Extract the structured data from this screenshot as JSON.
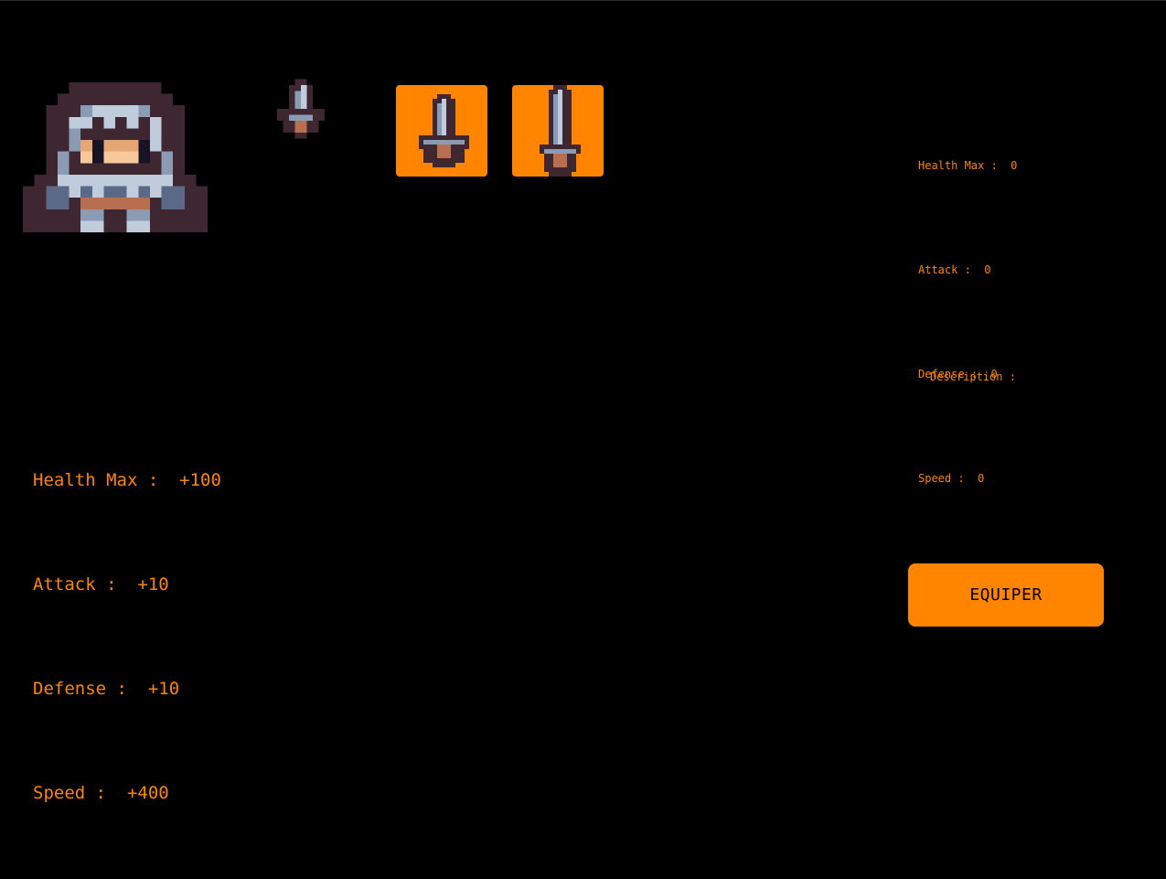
{
  "colors": {
    "background": "#000000",
    "accent": "#ff8400",
    "outline": "#3e2731",
    "steel": "#c0cbdc",
    "steel_dark": "#8b9bb4",
    "steel_shadow": "#5a6988",
    "skin": "#f7c899",
    "skin_shade": "#e4a672",
    "leather": "#b86f50",
    "eye": "#181425"
  },
  "hero": {
    "portrait_icon": "knight-portrait",
    "equipped_icon": "dagger-icon",
    "stats": [
      {
        "label": "Health Max :",
        "value": "+100"
      },
      {
        "label": "Attack :",
        "value": "+10"
      },
      {
        "label": "Defense :",
        "value": "+10"
      },
      {
        "label": "Speed :",
        "value": "+400"
      }
    ]
  },
  "inventory": {
    "slots": [
      {
        "icon": "dagger-icon"
      },
      {
        "icon": "sword-icon"
      }
    ]
  },
  "item_panel": {
    "stats": [
      {
        "label": "Health Max :",
        "value": "0"
      },
      {
        "label": "Attack :",
        "value": "0"
      },
      {
        "label": "Defense :",
        "value": "0"
      },
      {
        "label": "Speed :",
        "value": "0"
      }
    ],
    "description_label": "Description :",
    "equip_label": "EQUIPER"
  }
}
